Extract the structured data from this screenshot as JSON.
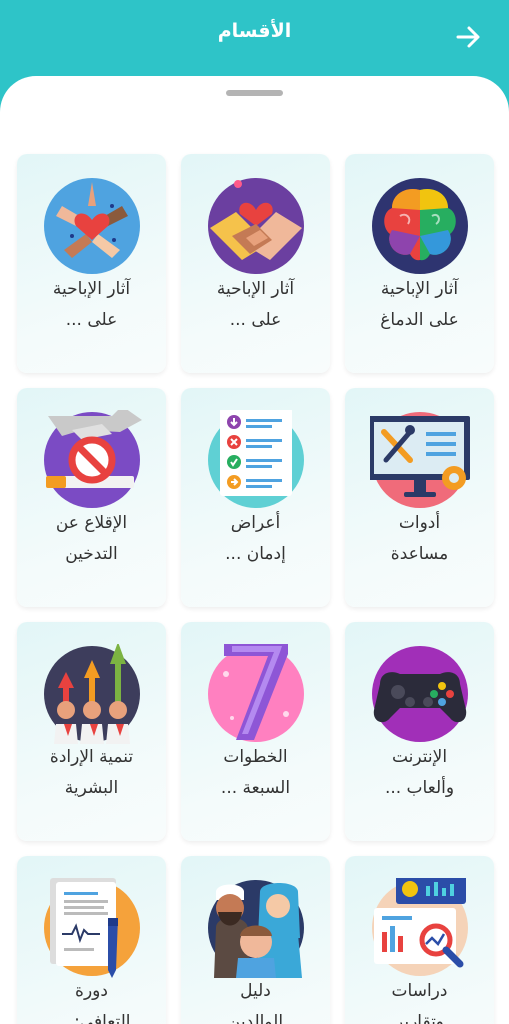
{
  "header": {
    "title": "الأقسام",
    "back_icon": "arrow-right-icon"
  },
  "colors": {
    "primary": "#2ec4c8",
    "card_bg": "#e9f8f8",
    "text": "#333333"
  },
  "sections": [
    {
      "line1": "آثار الإباحية",
      "line2": "على الدماغ",
      "icon": "brain-icon"
    },
    {
      "line1": "آثار الإباحية",
      "line2": "على ...",
      "icon": "holding-hands-heart-icon"
    },
    {
      "line1": "آثار الإباحية",
      "line2": "على ...",
      "icon": "hands-heart-icon"
    },
    {
      "line1": "أدوات",
      "line2": "مساعدة",
      "icon": "monitor-tools-icon"
    },
    {
      "line1": "أعراض",
      "line2": "إدمان ...",
      "icon": "checklist-icon"
    },
    {
      "line1": "الإقلاع عن",
      "line2": "التدخين",
      "icon": "no-smoking-icon"
    },
    {
      "line1": "الإنترنت",
      "line2": "وألعاب ...",
      "icon": "gamepad-icon"
    },
    {
      "line1": "الخطوات",
      "line2": "السبعة ...",
      "icon": "number-seven-icon"
    },
    {
      "line1": "تنمية الإرادة",
      "line2": "البشرية",
      "icon": "growth-arrows-people-icon"
    },
    {
      "line1": "دراسات",
      "line2": "وتقارير",
      "icon": "charts-magnifier-icon"
    },
    {
      "line1": "دليل",
      "line2": "الوالدين",
      "icon": "family-icon"
    },
    {
      "line1": "دورة",
      "line2": "التعافي: ...",
      "icon": "document-pen-icon"
    }
  ]
}
